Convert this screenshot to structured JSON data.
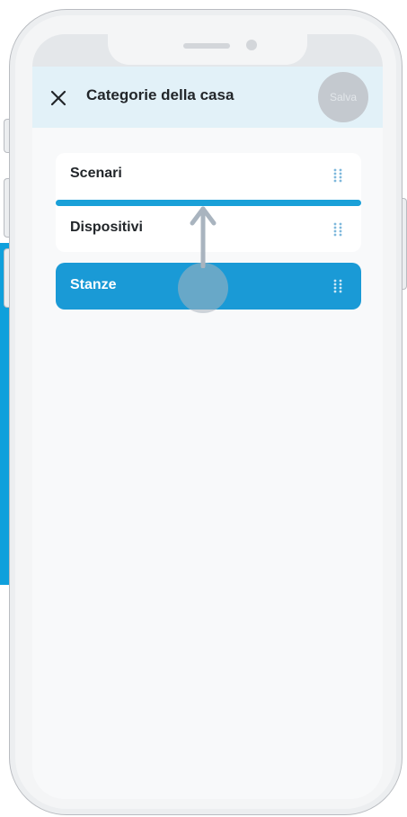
{
  "header": {
    "title": "Categorie della casa",
    "save_label": "Salva",
    "close_icon": "close-icon"
  },
  "list": {
    "items": [
      {
        "label": "Scenari"
      },
      {
        "label": "Dispositivi"
      }
    ],
    "dragged_item": {
      "label": "Stanze"
    }
  },
  "colors": {
    "accent": "#1a9ad6",
    "header_bg": "#e2f1f8",
    "save_button_bg": "#c4c9cf",
    "text_primary": "#22262a"
  },
  "icons": {
    "drag_handle": "drag-handle-icon",
    "gesture_arrow": "arrow-up-icon"
  }
}
